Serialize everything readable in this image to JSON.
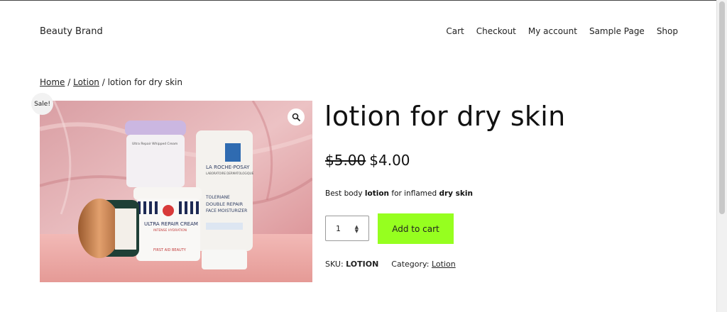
{
  "site": {
    "title": "Beauty Brand"
  },
  "nav": {
    "items": [
      "Cart",
      "Checkout",
      "My account",
      "Sample Page",
      "Shop"
    ]
  },
  "breadcrumb": {
    "home": "Home",
    "sep1": " / ",
    "category": "Lotion",
    "sep2": " / ",
    "current": "lotion for dry skin"
  },
  "product": {
    "title": "lotion for dry skin",
    "sale_badge": "Sale!",
    "price_old": "$5.00",
    "price_new": "$4.00",
    "description": {
      "prefix": "Best body ",
      "word1": "lotion",
      "middle": " for inflamed ",
      "word2": "dry skin"
    },
    "quantity": "1",
    "add_to_cart_label": "Add to cart",
    "sku_label": "SKU:",
    "sku_value": "LOTION",
    "category_label": "Category:",
    "category_value": "Lotion"
  },
  "image": {
    "product_texts": {
      "jar_top": "Ultra Repair Whipped Cream",
      "tube_brand": "LA ROCHE-POSAY",
      "tube_sub": "LABORATOIRE DERMATOLOGIQUE",
      "tube_line1": "TOLERIANE",
      "tube_line2": "DOUBLE REPAIR",
      "tube_line3": "FACE MOISTURIZER",
      "tub_name": "ULTRA REPAIR CREAM",
      "tub_sub": "INTENSE HYDRATION",
      "tub_tag": "FIRST AID BEAUTY"
    }
  },
  "colors": {
    "accent": "#96ff1f",
    "bg_pink": "#e8b1b4"
  },
  "icons": {
    "zoom": "magnifier-icon"
  }
}
